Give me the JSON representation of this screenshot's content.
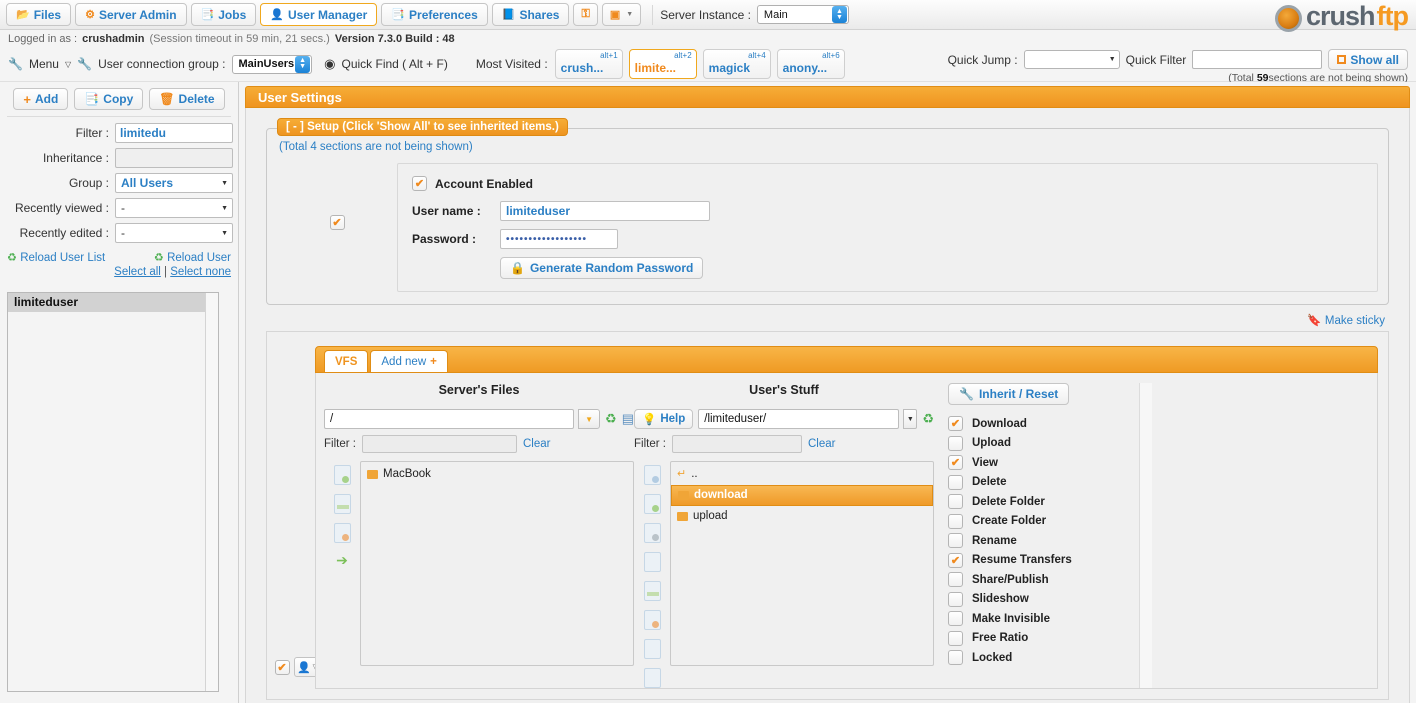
{
  "topbar": {
    "tabs": [
      {
        "label": "Files",
        "icon": "folder-icon",
        "active": false
      },
      {
        "label": "Server Admin",
        "icon": "gear-icon",
        "active": false
      },
      {
        "label": "Jobs",
        "icon": "copy-icon",
        "active": false
      },
      {
        "label": "User Manager",
        "icon": "user-icon",
        "active": true
      },
      {
        "label": "Preferences",
        "icon": "copy-icon",
        "active": false
      },
      {
        "label": "Shares",
        "icon": "book-icon",
        "active": false
      }
    ],
    "icon_buttons": [
      {
        "name": "lock-icon",
        "glyph": "⚿"
      },
      {
        "name": "monitor-icon",
        "glyph": "▣"
      }
    ],
    "server_instance_label": "Server Instance :",
    "server_instance_value": "Main",
    "logo_part1": "crush",
    "logo_part2": "ftp"
  },
  "info": {
    "logged_in_label": "Logged in as :",
    "user": "crushadmin",
    "session": "(Session timeout in 59 min, 21 secs.)",
    "version": "Version 7.3.0 Build : 48"
  },
  "menurow": {
    "menu_label": "Menu",
    "connection_group_label": "User connection group :",
    "connection_group_value": "MainUsers",
    "quick_find_label": "Quick Find ( Alt + F)",
    "most_visited_label": "Most Visited :",
    "most_visited": [
      {
        "name": "crush...",
        "alt": "alt+1",
        "active": false
      },
      {
        "name": "limite...",
        "alt": "alt+2",
        "active": true
      },
      {
        "name": "magick",
        "alt": "alt+4",
        "active": false
      },
      {
        "name": "anony...",
        "alt": "alt+6",
        "active": false
      }
    ],
    "quick_jump_label": "Quick Jump :",
    "quick_jump_value": "",
    "quick_filter_label": "Quick Filter",
    "quick_filter_value": "",
    "show_all_label": "Show all",
    "not_shown_pre": "(Total ",
    "not_shown_count": "59",
    "not_shown_post": "sections are not being shown)"
  },
  "sidebar": {
    "buttons": [
      {
        "label": "Add",
        "icon": "plus-icon"
      },
      {
        "label": "Copy",
        "icon": "copy-icon"
      },
      {
        "label": "Delete",
        "icon": "trash-icon"
      }
    ],
    "filter_label": "Filter :",
    "filter_value": "limitedu",
    "inheritance_label": "Inheritance :",
    "inheritance_value": "",
    "group_label": "Group :",
    "group_value": "All Users",
    "recently_viewed_label": "Recently viewed :",
    "recently_viewed_value": "-",
    "recently_edited_label": "Recently edited :",
    "recently_edited_value": "-",
    "reload_user_list": "Reload User List",
    "reload_user": "Reload User",
    "select_all": "Select all",
    "select_sep": "|",
    "select_none": "Select none",
    "users": [
      "limiteduser"
    ]
  },
  "main": {
    "panel_title": "User Settings",
    "setup_legend": "[ - ] Setup (Click 'Show All' to see inherited items.)",
    "setup_note": "(Total 4 sections are not being shown)",
    "account_enabled_label": "Account Enabled",
    "username_label": "User name :",
    "username_value": "limiteduser",
    "password_label": "Password :",
    "password_value": "••••••••••••••••••",
    "generate_password_label": "Generate Random Password",
    "make_sticky_label": "Make sticky"
  },
  "vfs": {
    "tabs": [
      {
        "label": "VFS",
        "active": true
      },
      {
        "label": "Add new",
        "active": false,
        "plus": "+"
      }
    ],
    "servers_files_header": "Server's Files",
    "users_stuff_header": "User's Stuff",
    "server_path": "/",
    "user_path": "/limiteduser/",
    "help_label": "Help",
    "filter_label": "Filter :",
    "clear_label": "Clear",
    "server_filter_value": "",
    "user_filter_value": "",
    "server_files": [
      {
        "name": "MacBook",
        "type": "folder",
        "selected": false
      }
    ],
    "user_files": [
      {
        "name": "..",
        "type": "up",
        "selected": false
      },
      {
        "name": "download",
        "type": "folder",
        "selected": true
      },
      {
        "name": "upload",
        "type": "folder",
        "selected": false
      }
    ],
    "inherit_reset_label": "Inherit / Reset",
    "permissions": [
      {
        "label": "Download",
        "checked": true
      },
      {
        "label": "Upload",
        "checked": false
      },
      {
        "label": "View",
        "checked": true
      },
      {
        "label": "Delete",
        "checked": false
      },
      {
        "label": "Delete Folder",
        "checked": false
      },
      {
        "label": "Create Folder",
        "checked": false
      },
      {
        "label": "Rename",
        "checked": false
      },
      {
        "label": "Resume Transfers",
        "checked": true
      },
      {
        "label": "Share/Publish",
        "checked": false
      },
      {
        "label": "Slideshow",
        "checked": false
      },
      {
        "label": "Make Invisible",
        "checked": false
      },
      {
        "label": "Free Ratio",
        "checked": false
      },
      {
        "label": "Locked",
        "checked": false
      }
    ]
  }
}
